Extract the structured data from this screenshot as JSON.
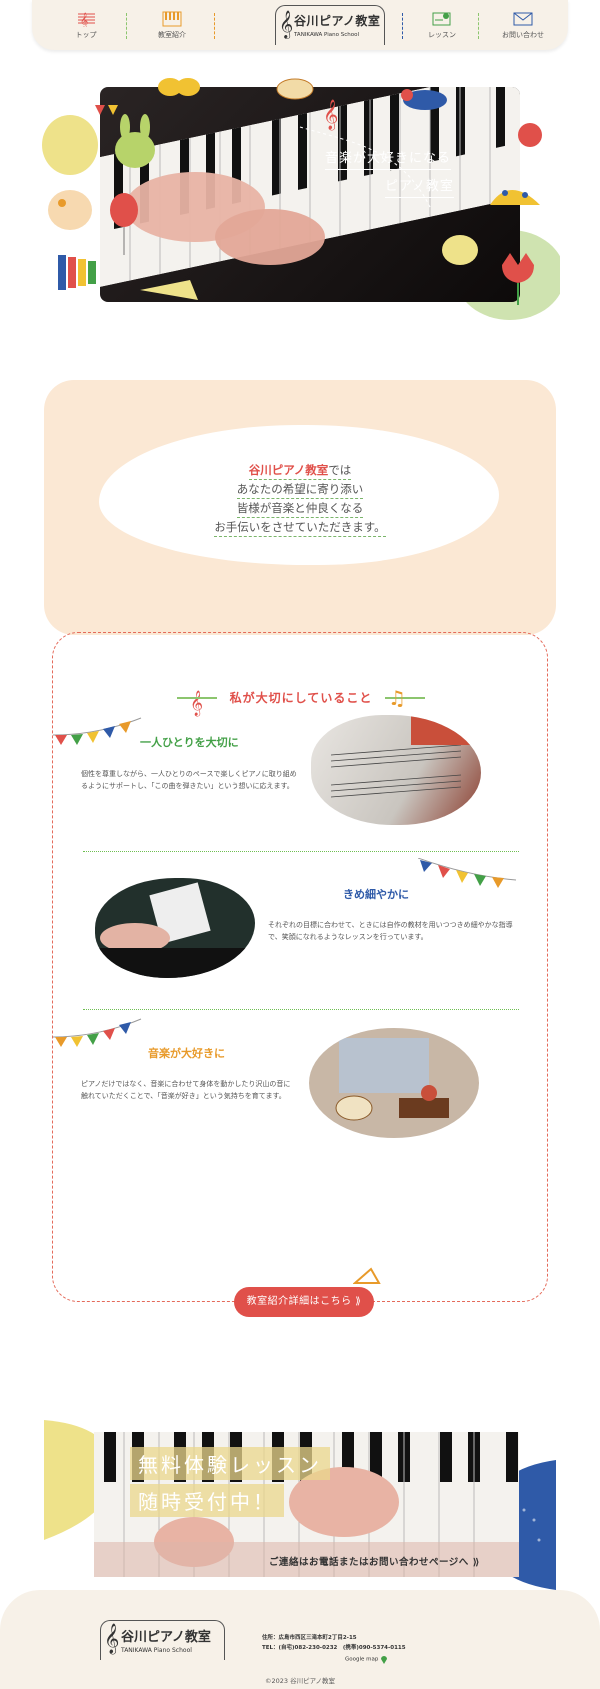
{
  "header": {
    "nav": [
      {
        "label": "トップ"
      },
      {
        "label": "教室紹介"
      },
      {
        "label": "レッスン"
      },
      {
        "label": "お問い合わせ"
      }
    ],
    "logo_jp": "谷川ピアノ教室",
    "logo_en": "TANIKAWA Piano School"
  },
  "hero": {
    "title_line1": "音楽が大好きになる",
    "title_line2": "ピアノ教室"
  },
  "intro": {
    "line1_highlight": "谷川ピアノ教室",
    "line1_rest": "では",
    "line2": "あなたの希望に寄り添い",
    "line3": "皆様が音楽と仲良くなる",
    "line4": "お手伝いをさせていただきます。"
  },
  "values": {
    "title": "私が大切にしていること",
    "items": [
      {
        "heading": "一人ひとりを大切に",
        "text": "個性を尊重しながら、一人ひとりのペースで楽しくピアノに取り組めるようにサポートし、「この曲を弾きたい」という想いに応えます。",
        "color": "#43a047"
      },
      {
        "heading": "きめ細やかに",
        "text": "それぞれの目標に合わせて、ときには自作の教材を用いつつきめ細やかな指導で、笑顔になれるようなレッスンを行っています。",
        "color": "#2f5aa8"
      },
      {
        "heading": "音楽が大好きに",
        "text": "ピアノだけではなく、音楽に合わせて身体を動かしたり沢山の音に触れていただくことで、「音楽が好き」という気持ちを育てます。",
        "color": "#e89a2a"
      }
    ]
  },
  "cta": {
    "label": "教室紹介詳細はこちら ⟫"
  },
  "lesson": {
    "line1": "無料体験レッスン",
    "line2": "随時受付中！",
    "link": "ご連絡はお電話またはお問い合わせページへ ⟫"
  },
  "footer": {
    "logo_jp": "谷川ピアノ教室",
    "logo_en": "TANIKAWA Piano School",
    "address": "住所：広島市西区三滝本町2丁目2-15",
    "tel": "TEL：(自宅)082-230-0232　(携帯)090-5374-0115",
    "map": "Google map",
    "copyright": "©2023 谷川ピアノ教室"
  },
  "colors": {
    "accent": "#e0504a",
    "cream": "#f7f1e8",
    "peach": "#fbe8d4",
    "green": "#8cc56e",
    "blue": "#2f5aa8"
  }
}
